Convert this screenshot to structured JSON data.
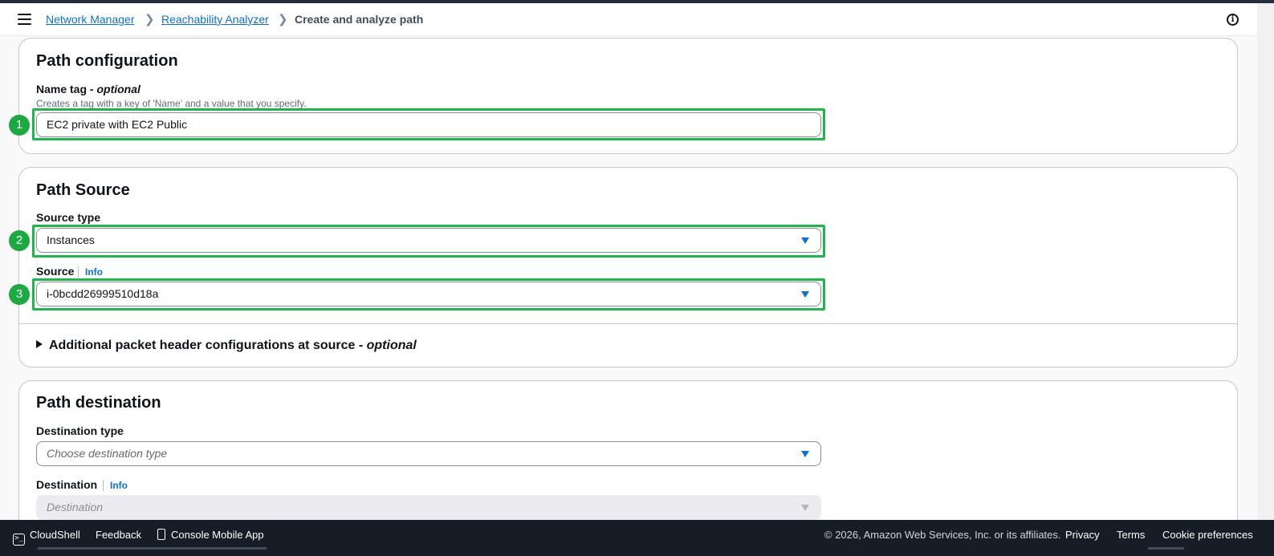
{
  "breadcrumbs": [
    {
      "label": "Network Manager"
    },
    {
      "label": "Reachability Analyzer"
    },
    {
      "label": "Create and analyze path"
    }
  ],
  "path_configuration": {
    "title": "Path configuration",
    "name_tag_label": "Name tag - ",
    "name_tag_optional": "optional",
    "name_tag_description": "Creates a tag with a key of 'Name' and a value that you specify.",
    "name_tag_value": "EC2 private with EC2 Public",
    "marker": "1"
  },
  "path_source": {
    "title": "Path Source",
    "source_type_label": "Source type",
    "source_type_value": "Instances",
    "source_type_marker": "2",
    "source_label": "Source",
    "source_info": "Info",
    "source_value": "i-0bcdd26999510d18a",
    "source_marker": "3",
    "additional_label": "Additional packet header configurations at source - ",
    "additional_optional": "optional"
  },
  "path_destination": {
    "title": "Path destination",
    "destination_type_label": "Destination type",
    "destination_type_placeholder": "Choose destination type",
    "destination_label": "Destination",
    "destination_info": "Info",
    "destination_placeholder": "Destination"
  },
  "footer": {
    "cloudshell": "CloudShell",
    "feedback": "Feedback",
    "mobile_app": "Console Mobile App",
    "copyright": "© 2026, Amazon Web Services, Inc. or its affiliates.",
    "privacy": "Privacy",
    "terms": "Terms",
    "cookie": "Cookie preferences"
  },
  "colors": {
    "highlight": "#1db84a",
    "link": "#0972d3",
    "footer_bg": "#161d26"
  }
}
